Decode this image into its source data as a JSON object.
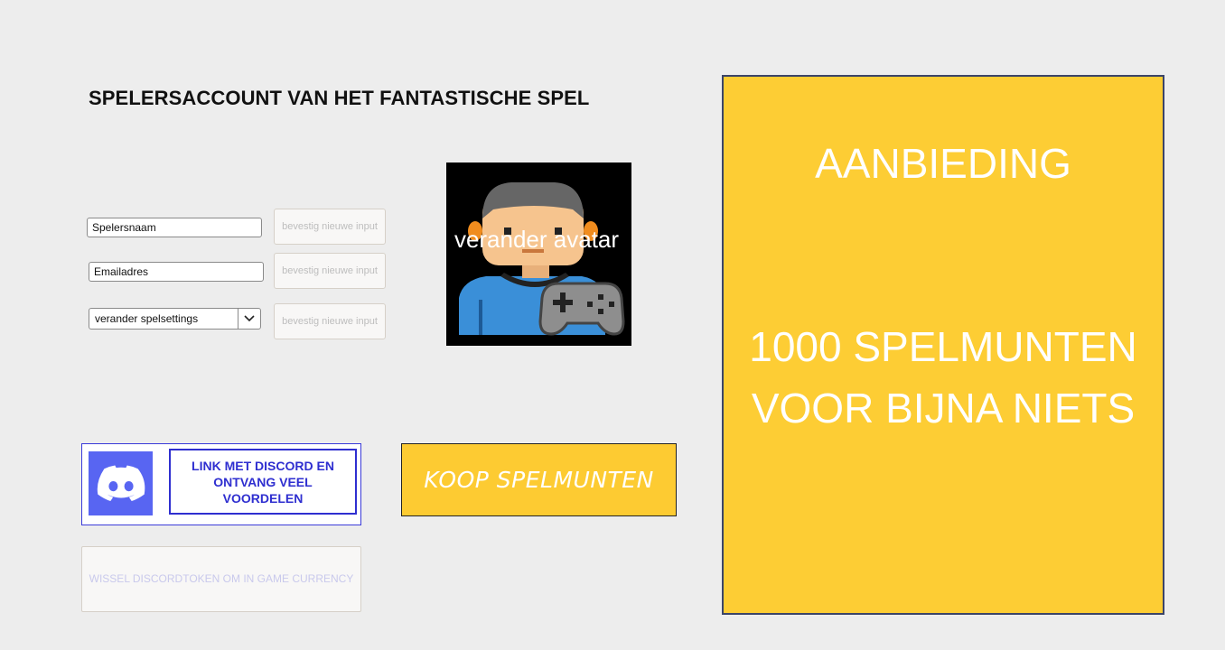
{
  "page": {
    "title": "SPELERSACCOUNT VAN HET FANTASTISCHE SPEL"
  },
  "form": {
    "player_name": {
      "value": "Spelersnaam"
    },
    "email": {
      "value": "Emailadres"
    },
    "settings_select": {
      "selected": "verander spelsettings"
    },
    "confirm_label": "bevestig nieuwe input"
  },
  "avatar": {
    "label": "verander avatar"
  },
  "discord": {
    "link_label": "LINK MET DISCORD EN ONTVANG VEEL VOORDELEN",
    "exchange_label": "WISSEL DISCORDTOKEN OM IN GAME CURRENCY"
  },
  "shop": {
    "buy_label": "KOOP SPELMUNTEN"
  },
  "offer": {
    "title": "AANBIEDING",
    "body": "1000 SPELMUNTEN VOOR BIJNA NIETS"
  },
  "colors": {
    "offer_yellow": "#fdcd34",
    "discord_blurple": "#5865f2",
    "discord_border": "#2f2fd0"
  },
  "icons": {
    "avatar": "gamer-avatar-icon",
    "controller": "game-controller-icon",
    "discord": "discord-logo-icon",
    "dropdown": "chevron-down-icon"
  }
}
